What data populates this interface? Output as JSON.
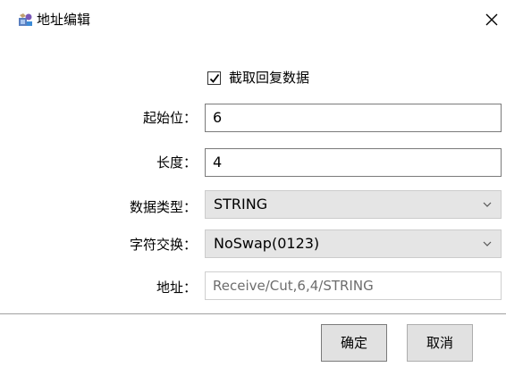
{
  "window": {
    "title": "地址编辑",
    "close_glyph": "✕"
  },
  "checkbox": {
    "label": "截取回复数据",
    "checked": true
  },
  "fields": {
    "start": {
      "label": "起始位：",
      "value": "6"
    },
    "length": {
      "label": "长度：",
      "value": "4"
    },
    "data_type": {
      "label": "数据类型：",
      "value": "STRING"
    },
    "char_swap": {
      "label": "字符交换：",
      "value": "NoSwap(0123)"
    },
    "address": {
      "label": "地址：",
      "value": "Receive/Cut,6,4/STRING"
    }
  },
  "buttons": {
    "ok": "确定",
    "cancel": "取消"
  },
  "icons": {
    "app": "app-icon",
    "close": "close-icon",
    "check": "checkmark-icon",
    "dropdown": "chevron-down-icon"
  },
  "colors": {
    "select_bg": "#e5e5e5",
    "button_bg": "#e1e1e1",
    "readonly_text": "#6d6d6d"
  }
}
